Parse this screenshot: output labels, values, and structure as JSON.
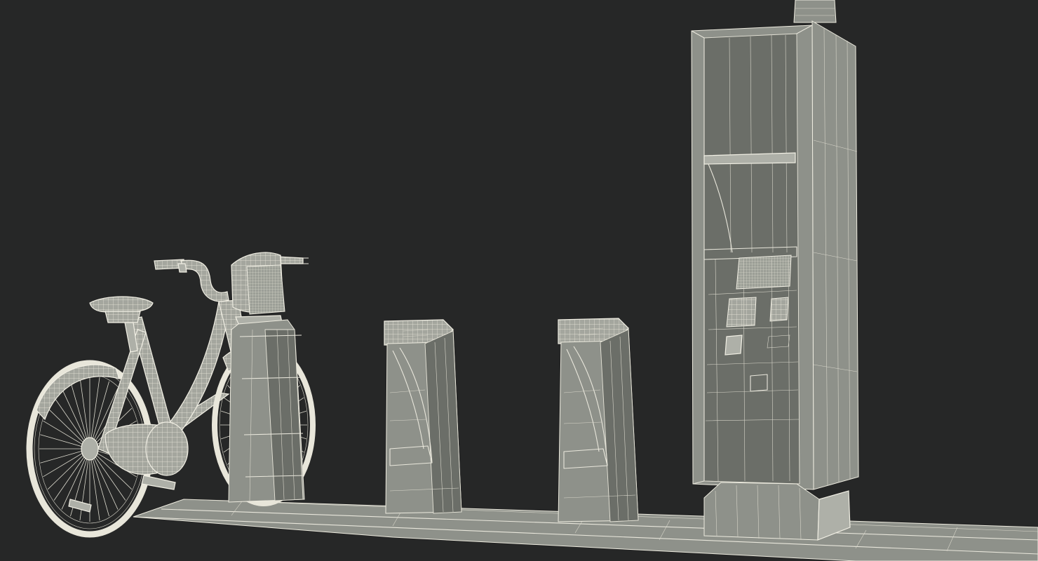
{
  "scene": {
    "background": "#262727",
    "wire_color": "#e9e7dc",
    "objects": [
      "bicycle",
      "bike-dock",
      "bike-dock",
      "bike-dock",
      "payment-kiosk",
      "base-platform"
    ]
  }
}
